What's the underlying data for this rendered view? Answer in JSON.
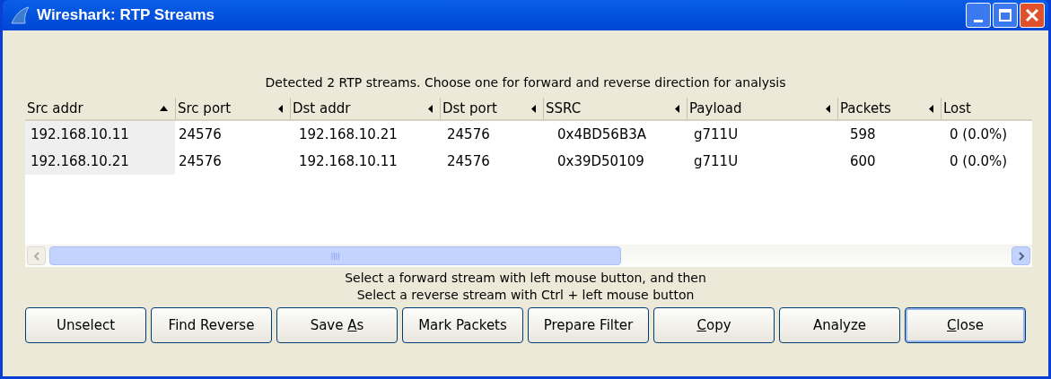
{
  "window": {
    "title": "Wireshark: RTP Streams"
  },
  "summary": "Detected 2 RTP streams. Choose one for forward and reverse direction for analysis",
  "table": {
    "columns": [
      {
        "label": "Src addr",
        "sorted": true
      },
      {
        "label": "Src port",
        "sorted": false
      },
      {
        "label": "Dst addr",
        "sorted": false
      },
      {
        "label": "Dst port",
        "sorted": false
      },
      {
        "label": "SSRC",
        "sorted": false
      },
      {
        "label": "Payload",
        "sorted": false
      },
      {
        "label": "Packets",
        "sorted": false
      },
      {
        "label": "Lost"
      }
    ],
    "rows": [
      [
        "192.168.10.11",
        "24576",
        "192.168.10.21",
        "24576",
        "0x4BD56B3A",
        "g711U",
        "598",
        "0 (0.0%)"
      ],
      [
        "192.168.10.21",
        "24576",
        "192.168.10.11",
        "24576",
        "0x39D50109",
        "g711U",
        "600",
        "0 (0.0%)"
      ]
    ]
  },
  "hint_lines": [
    "Select a forward stream with left mouse button, and then",
    "Select a reverse stream with Ctrl + left mouse button"
  ],
  "buttons": [
    {
      "before": "Unselect",
      "default": false
    },
    {
      "before": "Find Reverse",
      "default": false
    },
    {
      "before": "Save ",
      "access_key": "A",
      "after": "s",
      "default": false
    },
    {
      "before": "Mark Packets",
      "default": false
    },
    {
      "before": "Prepare Filter",
      "default": false
    },
    {
      "access_key": "C",
      "after": "opy",
      "default": false
    },
    {
      "before": "Analyze",
      "default": false
    },
    {
      "access_key": "C",
      "after": "lose",
      "default": true
    }
  ]
}
